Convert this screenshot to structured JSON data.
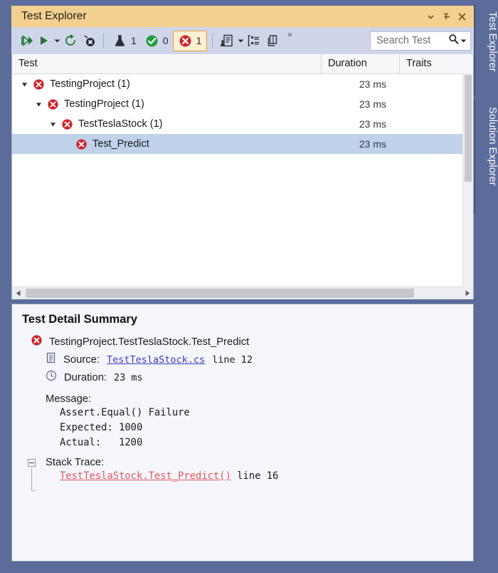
{
  "window": {
    "title": "Test Explorer",
    "title_controls": [
      {
        "name": "dropdown",
        "icon": "chevron-down-icon"
      },
      {
        "name": "pin",
        "icon": "pin-icon"
      },
      {
        "name": "close",
        "icon": "close-icon"
      }
    ]
  },
  "toolbar": {
    "run_all_tooltip": "Run All Tests",
    "run_tooltip": "Run",
    "run_dropdown_tooltip": "Run dropdown",
    "repeat_tooltip": "Repeat Last Run",
    "cancel_tooltip": "Cancel",
    "counts": {
      "total_label": "1",
      "passed_label": "0",
      "failed_label": "1"
    },
    "playlist_tooltip": "Playlist",
    "group_tooltip": "Group By",
    "columns_tooltip": "Columns",
    "overflow_label": "»",
    "search": {
      "placeholder": "Search Test",
      "icon": "search-icon"
    }
  },
  "list": {
    "columns": [
      "Test",
      "Duration",
      "Traits"
    ],
    "rows": [
      {
        "name": "TestingProject (1)",
        "duration": "23 ms",
        "traits": "",
        "depth": 0,
        "expanded": true,
        "status": "failed",
        "selected": false
      },
      {
        "name": "TestingProject (1)",
        "duration": "23 ms",
        "traits": "",
        "depth": 1,
        "expanded": true,
        "status": "failed",
        "selected": false
      },
      {
        "name": "TestTeslaStock (1)",
        "duration": "23 ms",
        "traits": "",
        "depth": 2,
        "expanded": true,
        "status": "failed",
        "selected": false
      },
      {
        "name": "Test_Predict",
        "duration": "23 ms",
        "traits": "",
        "depth": 3,
        "expanded": false,
        "status": "failed",
        "selected": true
      }
    ]
  },
  "detail": {
    "title": "Test Detail Summary",
    "test_name": "TestingProject.TestTeslaStock.Test_Predict",
    "source_label": "Source:",
    "source_link": "TestTeslaStock.cs",
    "source_line": "line 12",
    "duration_label": "Duration:",
    "duration_value": "23 ms",
    "message_label": "Message:",
    "message_lines": [
      "Assert.Equal() Failure",
      "Expected: 1000",
      "Actual:   1200"
    ],
    "stack_label": "Stack Trace:",
    "stack_link": "TestTeslaStock.Test_Predict()",
    "stack_line": "line 16"
  },
  "sidebar": {
    "tabs": [
      {
        "label": "Test Explorer"
      },
      {
        "label": "Solution Explorer"
      }
    ]
  },
  "colors": {
    "title_bar": "#F3D08E",
    "toolbar": "#CFD6EA",
    "frame": "#5B6C9B",
    "selection": "#BFD2EA",
    "failed_red": "#D0252C",
    "passed_green": "#1F9D3F",
    "source_link": "#3A3ABF",
    "stack_link": "#E4585C",
    "failed_badge_bg": "#FCEFD2",
    "failed_badge_border": "#E0A33A"
  }
}
